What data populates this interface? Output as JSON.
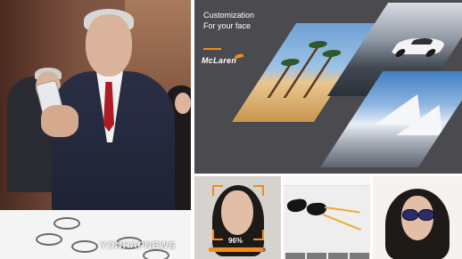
{
  "photo": {
    "watermark": "YONHAPNEWS"
  },
  "promo": {
    "headline_line1": "Customization",
    "headline_line2": "For your face",
    "brand_logo": "McLaren",
    "accent_color": "#f28c1c",
    "background_color": "#4b4b4f"
  },
  "screens": {
    "face_scan": {
      "progress_percent": 96,
      "progress_text": "96%"
    }
  }
}
